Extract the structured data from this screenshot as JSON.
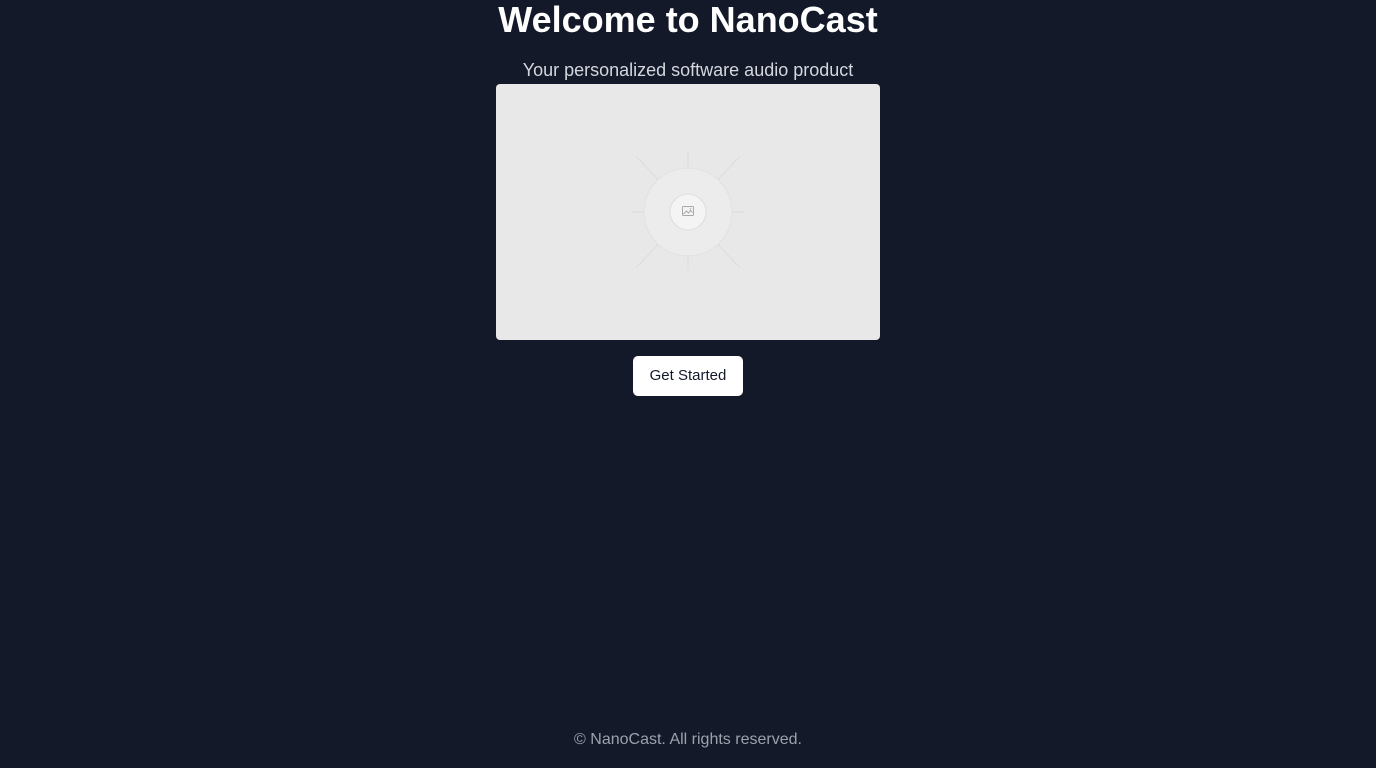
{
  "hero": {
    "title": "Welcome to NanoCast",
    "subtitle": "Your personalized software audio product"
  },
  "media": {
    "icon": "image-icon"
  },
  "cta": {
    "label": "Get Started"
  },
  "footer": {
    "text": "© NanoCast. All rights reserved."
  },
  "colors": {
    "background": "#131928",
    "title": "#ffffff",
    "subtitle": "#d4d7de",
    "placeholder": "#e8e8e8",
    "button_bg": "#ffffff",
    "button_text": "#131928",
    "footer_text": "#9ca1ad"
  }
}
